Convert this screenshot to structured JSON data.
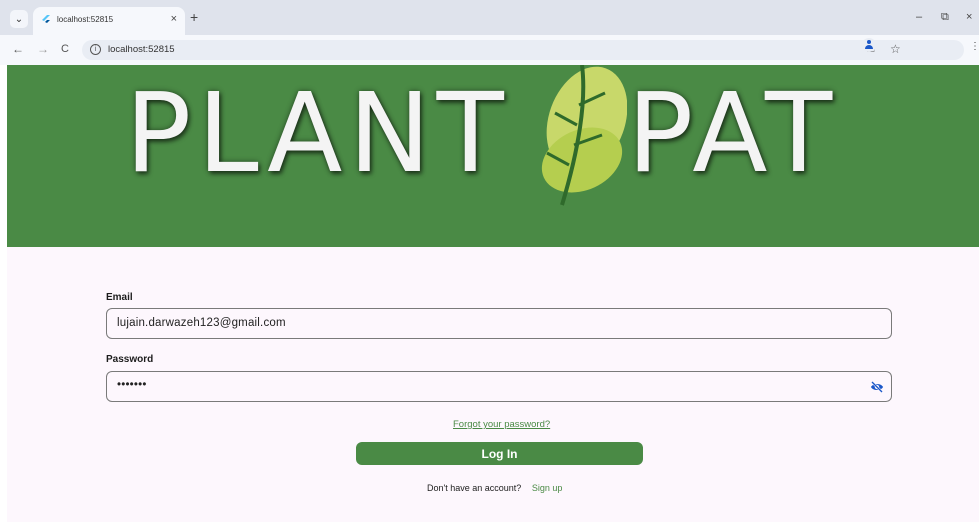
{
  "browser": {
    "tab_title": "localhost:52815",
    "tab_close": "×",
    "new_tab": "+",
    "url": "localhost:52815",
    "window_controls": {
      "minimize": "–",
      "restore": "⧉",
      "close": "×"
    },
    "nav": {
      "back": "←",
      "forward": "→",
      "reload": "C"
    }
  },
  "banner": {
    "title_left": "PLANT",
    "title_right": "PAT"
  },
  "form": {
    "email_label": "Email",
    "email_value": "lujain.darwazeh123@gmail.com",
    "password_label": "Password",
    "password_value": "•••••••",
    "forgot_link": "Forgot your password?",
    "login_button": "Log In",
    "signup_prompt": "Don't have an account?",
    "signup_link": "Sign up"
  },
  "colors": {
    "brand_green": "#4a8a45",
    "page_bg": "#fdf7fd",
    "eye_icon": "#1a57c8"
  },
  "icons": [
    "tab-dropdown-icon",
    "flutter-favicon-icon",
    "info-icon",
    "key-icon",
    "star-icon",
    "profile-icon",
    "kebab-menu-icon",
    "eye-off-icon"
  ]
}
